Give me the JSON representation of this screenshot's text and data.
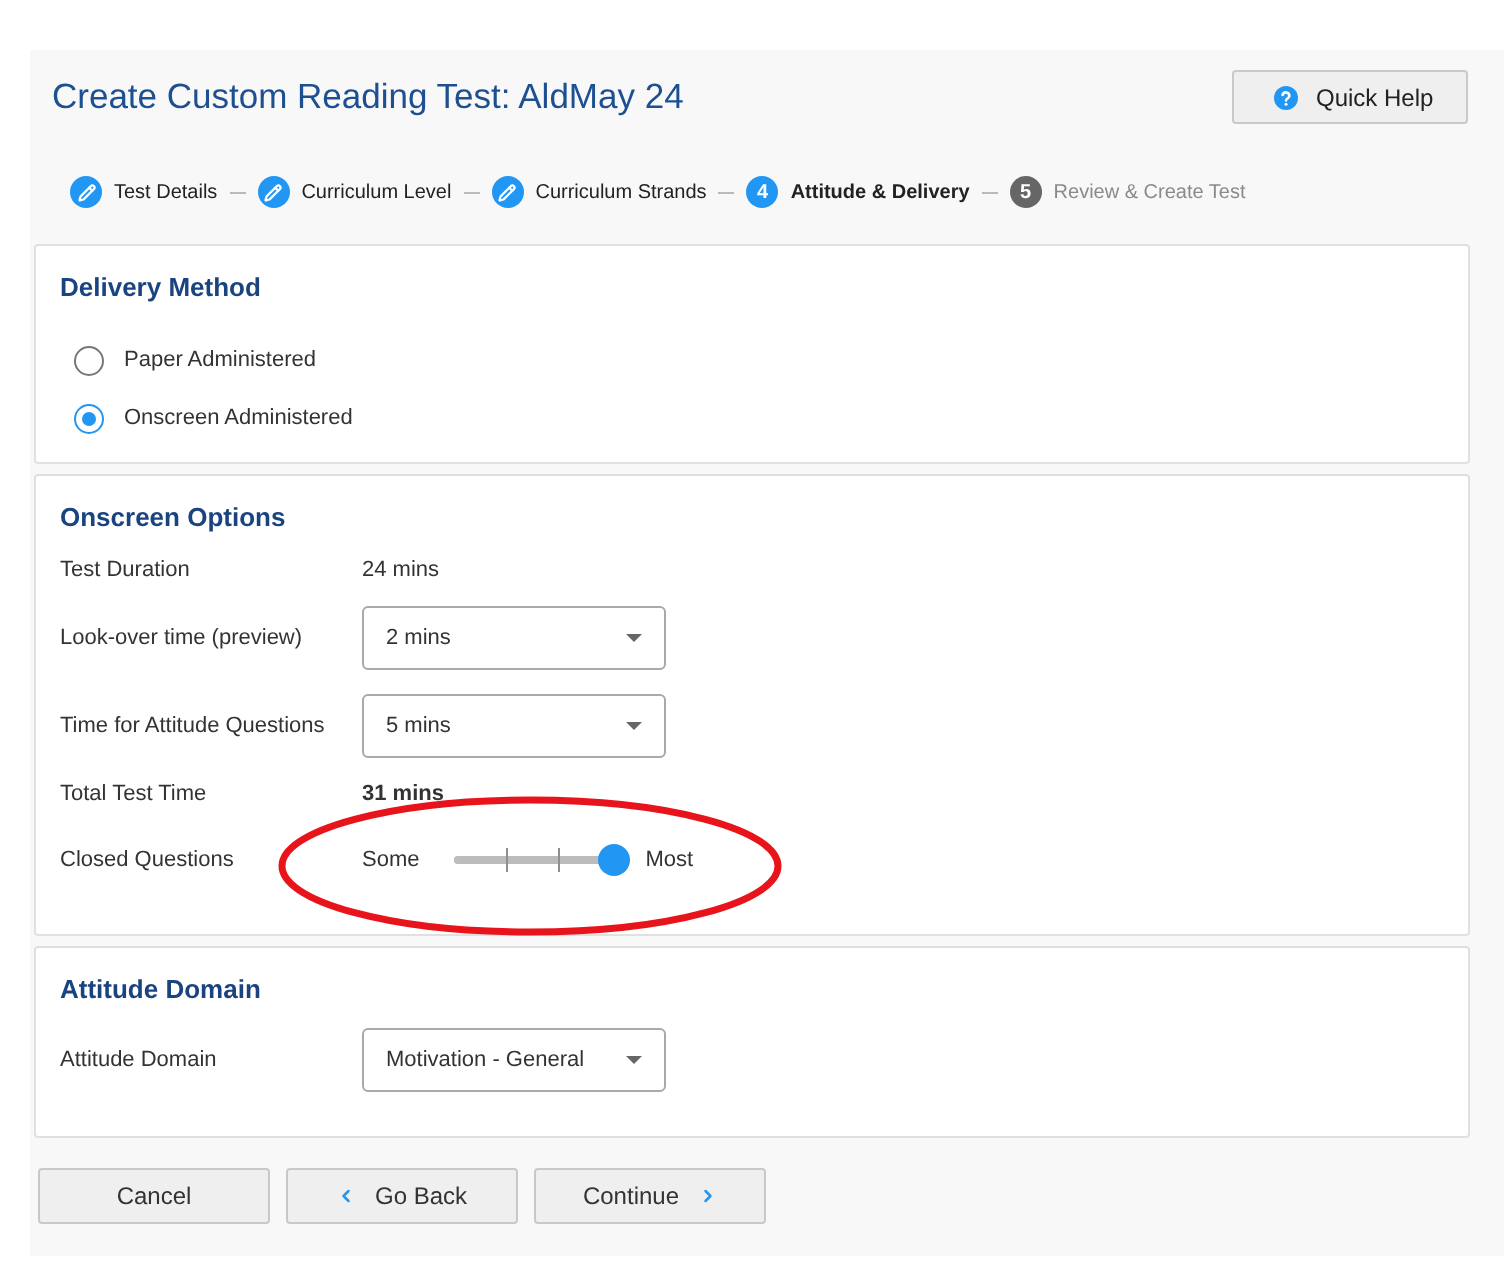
{
  "page": {
    "title": "Create Custom Reading Test: AldMay 24",
    "help_button": "Quick Help"
  },
  "steps": [
    {
      "label": "Test Details",
      "completed": true,
      "selected": false
    },
    {
      "label": "Curriculum Level",
      "completed": true,
      "selected": false
    },
    {
      "label": "Curriculum Strands",
      "completed": true,
      "selected": false
    },
    {
      "number": "4",
      "label": "Attitude & Delivery",
      "completed": false,
      "selected": true
    },
    {
      "number": "5",
      "label": "Review & Create Test",
      "completed": false,
      "selected": false
    }
  ],
  "delivery_method": {
    "heading": "Delivery Method",
    "options": [
      {
        "label": "Paper Administered",
        "selected": false
      },
      {
        "label": "Onscreen Administered",
        "selected": true
      }
    ]
  },
  "onscreen_options": {
    "heading": "Onscreen Options",
    "rows": [
      {
        "kind": "info",
        "label": "Test Duration",
        "value": "24 mins",
        "bold": false
      },
      {
        "kind": "select",
        "label": "Look-over time (preview)",
        "value": "2 mins"
      },
      {
        "kind": "select",
        "label": "Time for Attitude Questions",
        "value": "5 mins"
      },
      {
        "kind": "info",
        "label": "Total Test Time",
        "value": "31 mins",
        "bold": true
      },
      {
        "kind": "slider",
        "label": "Closed Questions",
        "min_label": "Some",
        "max_label": "Most",
        "level": 1
      }
    ]
  },
  "attitude_domain": {
    "heading": "Attitude Domain",
    "rows": [
      {
        "kind": "select",
        "label": "Attitude Domain",
        "value": "Motivation - General"
      }
    ]
  },
  "buttons": [
    {
      "kind": "cancel",
      "label": "Cancel"
    },
    {
      "kind": "back",
      "label": "Go Back"
    },
    {
      "kind": "next",
      "label": "Continue"
    }
  ]
}
